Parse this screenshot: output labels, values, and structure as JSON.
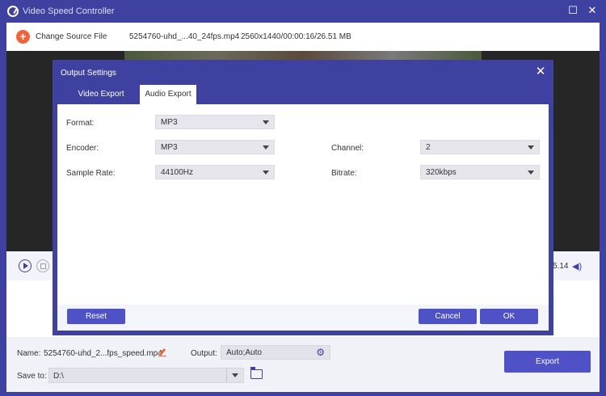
{
  "app": {
    "title": "Video Speed Controller"
  },
  "toolbar": {
    "change_source_label": "Change Source File",
    "file_name": "5254760-uhd_...40_24fps.mp4",
    "file_info": "2560x1440/00:00:16/26.51 MB"
  },
  "controls": {
    "time_end": "5.14"
  },
  "bottom": {
    "name_label": "Name:",
    "name_value": "5254760-uhd_2...fps_speed.mp4",
    "output_label": "Output:",
    "output_value": "Auto;Auto",
    "save_label": "Save to:",
    "save_value": "D:\\",
    "export_label": "Export"
  },
  "dialog": {
    "title": "Output Settings",
    "tabs": [
      {
        "label": "Video Export",
        "active": false
      },
      {
        "label": "Audio Export",
        "active": true
      }
    ],
    "fields": {
      "format": {
        "label": "Format:",
        "value": "MP3"
      },
      "encoder": {
        "label": "Encoder:",
        "value": "MP3"
      },
      "sample_rate": {
        "label": "Sample Rate:",
        "value": "44100Hz"
      },
      "channel": {
        "label": "Channel:",
        "value": "2"
      },
      "bitrate": {
        "label": "Bitrate:",
        "value": "320kbps"
      }
    },
    "reset_label": "Reset",
    "cancel_label": "Cancel",
    "ok_label": "OK"
  },
  "colors": {
    "accent": "#3f41a0",
    "button": "#4f51c7",
    "add_icon": "#f0623a"
  }
}
